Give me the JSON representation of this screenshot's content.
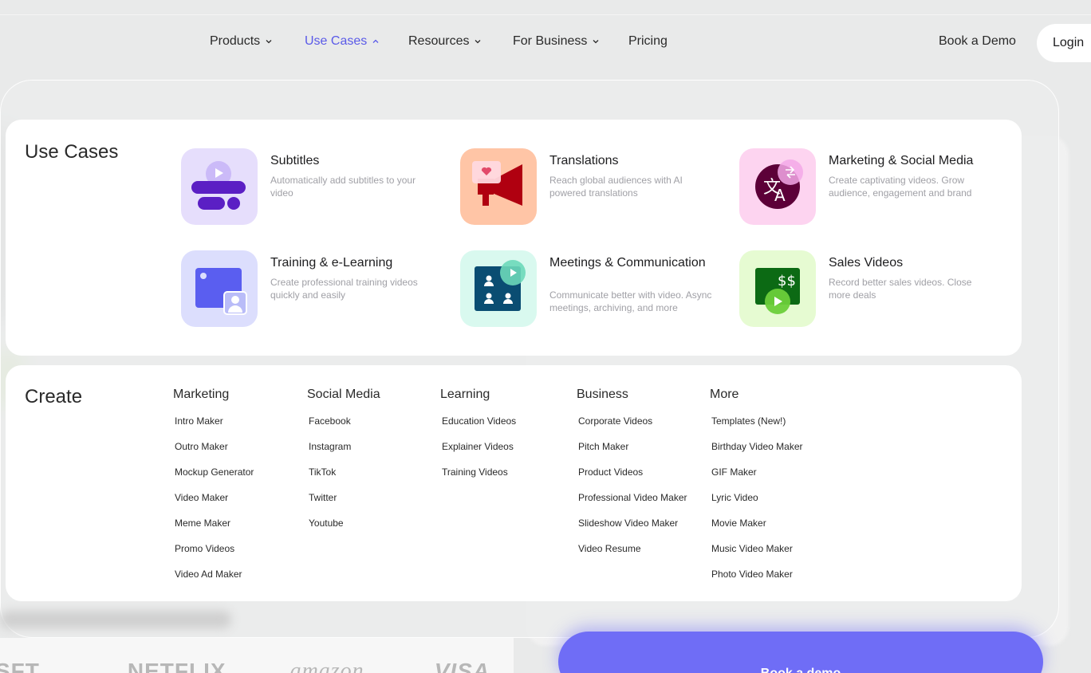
{
  "nav": {
    "items": [
      {
        "label": "Products"
      },
      {
        "label": "Use Cases"
      },
      {
        "label": "Resources"
      },
      {
        "label": "For Business"
      },
      {
        "label": "Pricing"
      }
    ],
    "book_demo": "Book a Demo",
    "login": "Login"
  },
  "use_cases": {
    "title": "Use Cases",
    "items": [
      {
        "name": "Subtitles",
        "desc": "Automatically add subtitles to your video",
        "icon": "subtitles-icon",
        "bg": "#e6defc"
      },
      {
        "name": "Translations",
        "desc": "Reach global audiences with AI powered translations",
        "icon": "megaphone-icon",
        "bg": "#ffc5a6"
      },
      {
        "name": "Marketing & Social Media",
        "desc": "Create captivating videos. Grow audience, engagement and brand",
        "icon": "translate-icon",
        "bg": "#fdd4f0"
      },
      {
        "name": "Training & e-Learning",
        "desc": "Create professional training videos quickly and easily",
        "icon": "presentation-icon",
        "bg": "#dcdefd"
      },
      {
        "name": "Meetings & Communication",
        "desc": "Communicate better with video. Async meetings, archiving, and more",
        "icon": "meeting-icon",
        "bg": "#d9f9ef"
      },
      {
        "name": "Sales Videos",
        "desc": "Record better sales videos. Close more deals",
        "icon": "sales-icon",
        "bg": "#e6fbd2"
      }
    ]
  },
  "create": {
    "title": "Create",
    "columns": [
      {
        "heading": "Marketing",
        "links": [
          "Intro Maker",
          "Outro Maker",
          "Mockup Generator",
          "Video Maker",
          "Meme Maker",
          "Promo Videos",
          "Video Ad Maker"
        ]
      },
      {
        "heading": "Social Media",
        "links": [
          "Facebook",
          "Instagram",
          "TikTok",
          "Twitter",
          "Youtube"
        ]
      },
      {
        "heading": "Learning",
        "links": [
          "Education Videos",
          "Explainer Videos",
          "Training Videos"
        ]
      },
      {
        "heading": "Business",
        "links": [
          "Corporate Videos",
          "Pitch Maker",
          "Product Videos",
          "Professional Video Maker",
          "Slideshow Video Maker",
          "Video Resume"
        ]
      },
      {
        "heading": "More",
        "links": [
          "Templates (New!)",
          "Birthday Video Maker",
          "GIF Maker",
          "Lyric Video",
          "Movie Maker",
          "Music Video Maker",
          "Photo Video Maker"
        ]
      }
    ]
  },
  "background": {
    "logos": [
      "SFT",
      "NETFLIX",
      "amazon",
      "VISA"
    ],
    "cta": "Book a demo"
  },
  "colors": {
    "accent": "#5a5ae8",
    "cta": "#6f6df6"
  }
}
